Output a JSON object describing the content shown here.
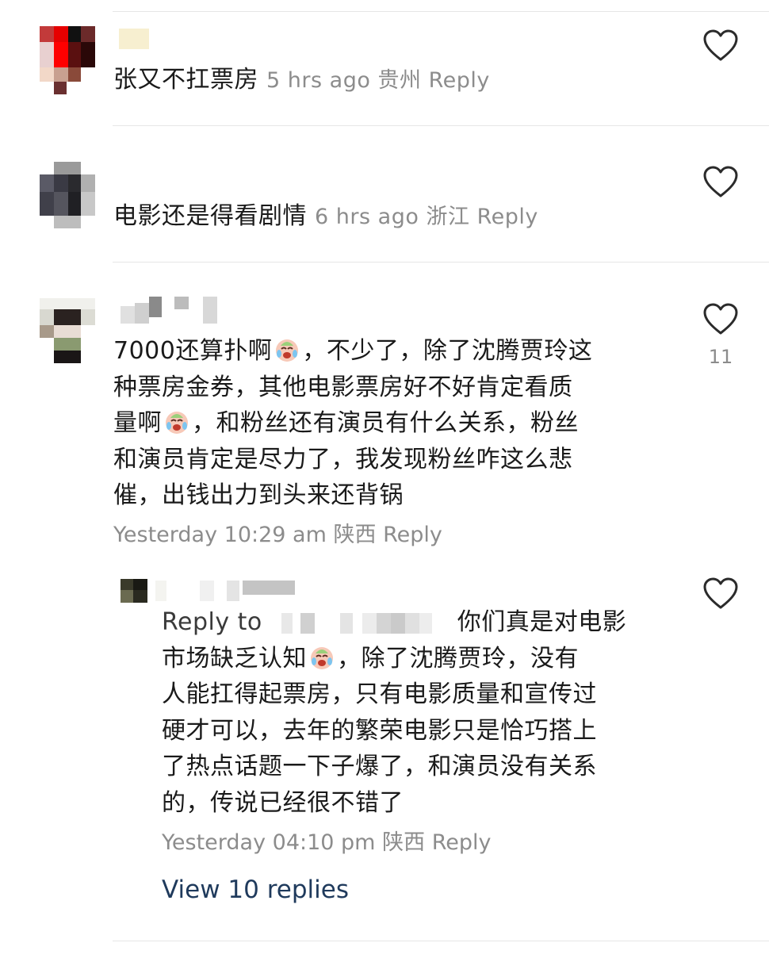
{
  "comments": [
    {
      "text": "张又不扛票房",
      "time": "5 hrs ago",
      "location": "贵州",
      "reply_label": "Reply",
      "like_icon": "heart-outline-icon"
    },
    {
      "text": "电影还是得看剧情",
      "time": "6 hrs ago",
      "location": "浙江",
      "reply_label": "Reply",
      "like_icon": "heart-outline-icon"
    },
    {
      "text_lines": [
        "7000还算扑啊",
        "，不少了，除了沈腾贾玲这",
        "种票房金券，其他电影票房好不好肯定看质",
        "量啊",
        "，和粉丝还有演员有什么关系，粉丝",
        "和演员肯定是尽力了，我发现粉丝咋这么悲",
        "催，出钱出力到头来还背锅"
      ],
      "time": "Yesterday 10:29 am",
      "location": "陕西",
      "reply_label": "Reply",
      "like_icon": "heart-outline-icon",
      "like_count": "11",
      "reply": {
        "prefix": "Reply to",
        "text_lines": [
          "你们真是对电影",
          "市场缺乏认知",
          "，除了沈腾贾玲，没有",
          "人能扛得起票房，只有电影质量和宣传过",
          "硬才可以，去年的繁荣电影只是恰巧搭上",
          "了热点话题一下子爆了，和演员没有关系",
          "的，传说已经很不错了"
        ],
        "time": "Yesterday 04:10 pm",
        "location": "陕西",
        "reply_label": "Reply",
        "like_icon": "heart-outline-icon"
      },
      "view_replies": "View 10 replies"
    }
  ],
  "colors": {
    "text": "#1a1a1a",
    "meta": "#8c8c8c",
    "link": "#1f3a5c",
    "divider": "#e6e6e6"
  }
}
